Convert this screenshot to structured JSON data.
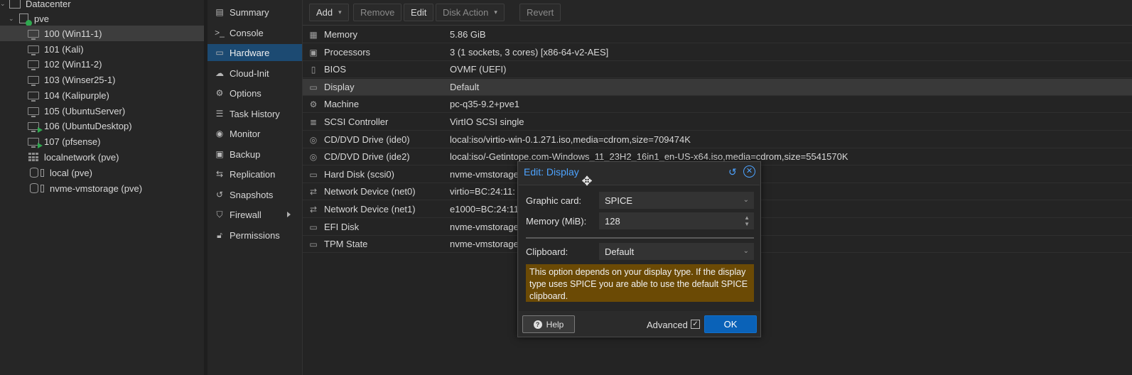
{
  "tree": {
    "datacenter": "Datacenter",
    "node": "pve",
    "vms": [
      {
        "label": "100 (Win11-1)",
        "running": false
      },
      {
        "label": "101 (Kali)",
        "running": false
      },
      {
        "label": "102 (Win11-2)",
        "running": false
      },
      {
        "label": "103 (Winser25-1)",
        "running": false
      },
      {
        "label": "104 (Kalipurple)",
        "running": false
      },
      {
        "label": "105 (UbuntuServer)",
        "running": false
      },
      {
        "label": "106 (UbuntuDesktop)",
        "running": true
      },
      {
        "label": "107 (pfsense)",
        "running": true
      }
    ],
    "network": "localnetwork (pve)",
    "storages": [
      "local (pve)",
      "nvme-vmstorage (pve)"
    ]
  },
  "nav": {
    "items": [
      "Summary",
      "Console",
      "Hardware",
      "Cloud-Init",
      "Options",
      "Task History",
      "Monitor",
      "Backup",
      "Replication",
      "Snapshots",
      "Firewall",
      "Permissions"
    ],
    "active": "Hardware"
  },
  "toolbar": {
    "add": "Add",
    "remove": "Remove",
    "edit": "Edit",
    "disk_action": "Disk Action",
    "revert": "Revert"
  },
  "hardware": [
    {
      "name": "Memory",
      "value": "5.86 GiB",
      "icon": "memory-icon"
    },
    {
      "name": "Processors",
      "value": "3 (1 sockets, 3 cores) [x86-64-v2-AES]",
      "icon": "cpu-icon"
    },
    {
      "name": "BIOS",
      "value": "OVMF (UEFI)",
      "icon": "bios-icon"
    },
    {
      "name": "Display",
      "value": "Default",
      "icon": "display-icon"
    },
    {
      "name": "Machine",
      "value": "pc-q35-9.2+pve1",
      "icon": "machine-icon"
    },
    {
      "name": "SCSI Controller",
      "value": "VirtIO SCSI single",
      "icon": "database-icon"
    },
    {
      "name": "CD/DVD Drive (ide0)",
      "value": "local:iso/virtio-win-0.1.271.iso,media=cdrom,size=709474K",
      "icon": "cdrom-icon"
    },
    {
      "name": "CD/DVD Drive (ide2)",
      "value": "local:iso/-Getintope.com-Windows_11_23H2_16in1_en-US-x64.iso,media=cdrom,size=5541570K",
      "icon": "cdrom-icon"
    },
    {
      "name": "Hard Disk (scsi0)",
      "value": "nvme-vmstorage",
      "icon": "harddisk-icon"
    },
    {
      "name": "Network Device (net0)",
      "value": "virtio=BC:24:11:",
      "icon": "network-icon"
    },
    {
      "name": "Network Device (net1)",
      "value": "e1000=BC:24:11",
      "icon": "network-icon"
    },
    {
      "name": "EFI Disk",
      "value": "nvme-vmstorage",
      "icon": "harddisk-icon"
    },
    {
      "name": "TPM State",
      "value": "nvme-vmstorage",
      "icon": "harddisk-icon"
    }
  ],
  "dialog": {
    "title": "Edit: Display",
    "graphic_card_label": "Graphic card:",
    "graphic_card_value": "SPICE",
    "memory_label": "Memory (MiB):",
    "memory_value": "128",
    "clipboard_label": "Clipboard:",
    "clipboard_value": "Default",
    "warning": "This option depends on your display type. If the display type uses SPICE you are able to use the default SPICE clipboard.",
    "help": "Help",
    "advanced": "Advanced",
    "advanced_checked": true,
    "ok": "OK"
  },
  "colors": {
    "accent": "#4da3ff",
    "primary_button": "#0a62b8",
    "nav_active": "#1c4a72",
    "warning_bg": "#6b4a05",
    "running": "#2fa84f"
  }
}
